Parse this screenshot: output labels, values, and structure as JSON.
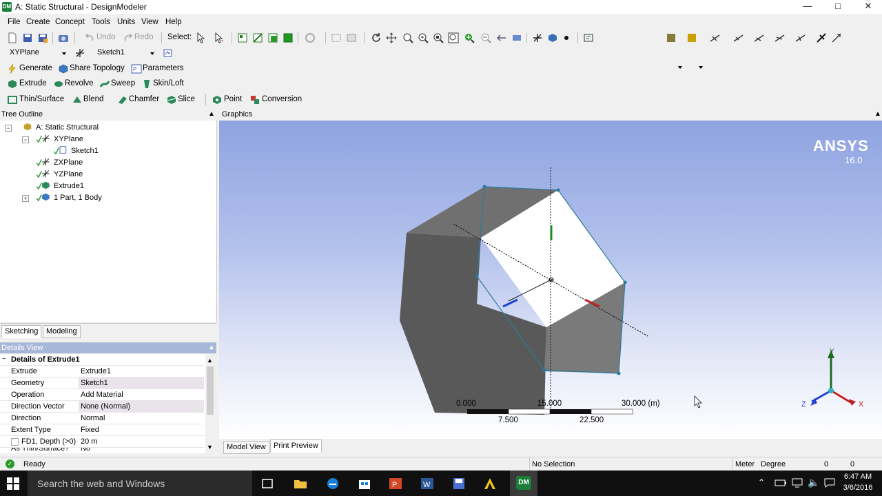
{
  "window": {
    "title": "A: Static Structural - DesignModeler",
    "app_icon": "DM"
  },
  "menus": [
    "File",
    "Create",
    "Concept",
    "Tools",
    "Units",
    "View",
    "Help"
  ],
  "toolbar1": {
    "undo": "Undo",
    "redo": "Redo",
    "select": "Select:"
  },
  "toolbar2": {
    "plane": "XYPlane",
    "sketch": "Sketch1"
  },
  "toolbar3": {
    "generate": "Generate",
    "share_topology": "Share Topology",
    "parameters": "Parameters"
  },
  "toolbar4": {
    "extrude": "Extrude",
    "revolve": "Revolve",
    "sweep": "Sweep",
    "skin_loft": "Skin/Loft"
  },
  "toolbar5": {
    "thin_surface": "Thin/Surface",
    "blend": "Blend",
    "chamfer": "Chamfer",
    "slice": "Slice",
    "point": "Point",
    "conversion": "Conversion"
  },
  "tree": {
    "header": "Tree Outline",
    "items": [
      {
        "label": "A: Static Structural"
      },
      {
        "label": "XYPlane"
      },
      {
        "label": "Sketch1"
      },
      {
        "label": "ZXPlane"
      },
      {
        "label": "YZPlane"
      },
      {
        "label": "Extrude1"
      },
      {
        "label": "1 Part, 1 Body"
      }
    ]
  },
  "tabs": {
    "sketching": "Sketching",
    "modeling": "Modeling"
  },
  "details": {
    "header": "Details View",
    "section": "Details of Extrude1",
    "rows": [
      {
        "key": "Extrude",
        "value": "Extrude1"
      },
      {
        "key": "Geometry",
        "value": "Sketch1"
      },
      {
        "key": "Operation",
        "value": "Add Material"
      },
      {
        "key": "Direction Vector",
        "value": "None (Normal)"
      },
      {
        "key": "Direction",
        "value": "Normal"
      },
      {
        "key": "Extent Type",
        "value": "Fixed"
      },
      {
        "key": "FD1, Depth (>0)",
        "value": "20 m"
      },
      {
        "key": "As Thin/Surface?",
        "value": "No"
      }
    ]
  },
  "graphics": {
    "header": "Graphics",
    "brand": "ANSYS",
    "version": "16.0",
    "scale": {
      "top": [
        "0.000",
        "15.000",
        "30.000 (m)"
      ],
      "bottom": [
        "7.500",
        "22.500"
      ]
    },
    "triad": {
      "x": "X",
      "y": "Y",
      "z": "Z"
    }
  },
  "view_tabs": {
    "model_view": "Model View",
    "print_preview": "Print Preview"
  },
  "status": {
    "ready": "Ready",
    "selection": "No Selection",
    "length_unit": "Meter",
    "angle_unit": "Degree",
    "v1": "0",
    "v2": "0"
  },
  "taskbar": {
    "search": "Search the web and Windows",
    "time": "6:47 AM",
    "date": "3/6/2016"
  },
  "colors": {
    "accent_green": "#1a7d3a",
    "viewport_top": "#8ea3e0",
    "taskbar": "#101010"
  }
}
